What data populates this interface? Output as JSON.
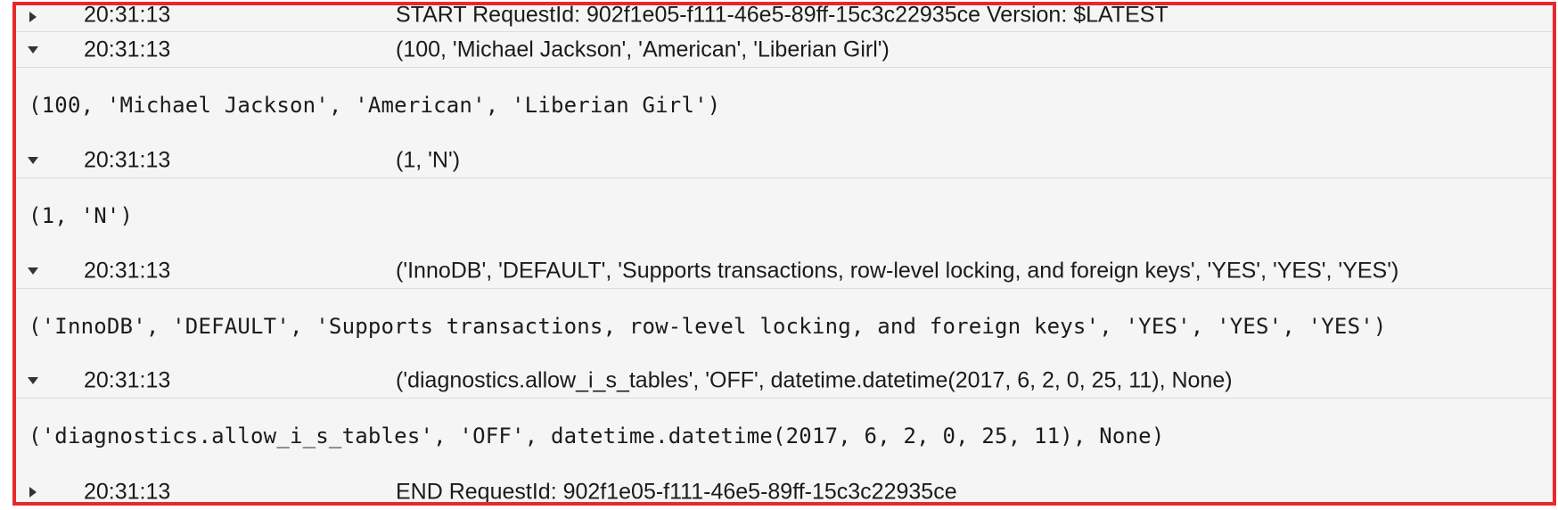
{
  "log": {
    "events": [
      {
        "time": "20:31:13",
        "message": "START RequestId: 902f1e05-f111-46e5-89ff-15c3c22935ce Version: $LATEST",
        "expanded": false
      },
      {
        "time": "20:31:13",
        "message": "(100, 'Michael Jackson', 'American', 'Liberian Girl')",
        "expanded": true,
        "detail": "(100, 'Michael Jackson', 'American', 'Liberian Girl')"
      },
      {
        "time": "20:31:13",
        "message": "(1, 'N')",
        "expanded": true,
        "detail": "(1, 'N')"
      },
      {
        "time": "20:31:13",
        "message": "('InnoDB', 'DEFAULT', 'Supports transactions, row-level locking, and foreign keys', 'YES', 'YES', 'YES')",
        "expanded": true,
        "detail": "('InnoDB', 'DEFAULT', 'Supports transactions, row-level locking, and foreign keys', 'YES', 'YES', 'YES')"
      },
      {
        "time": "20:31:13",
        "message": "('diagnostics.allow_i_s_tables', 'OFF', datetime.datetime(2017, 6, 2, 0, 25, 11), None)",
        "expanded": true,
        "detail": "('diagnostics.allow_i_s_tables', 'OFF', datetime.datetime(2017, 6, 2, 0, 25, 11), None)"
      },
      {
        "time": "20:31:13",
        "message": "END RequestId: 902f1e05-f111-46e5-89ff-15c3c22935ce",
        "expanded": false
      }
    ]
  },
  "colors": {
    "highlight_border": "#e8292b",
    "row_background": "#f5f5f5",
    "text": "#1b1b1b"
  },
  "icons": {
    "collapsed": "caret-right-icon",
    "expanded": "caret-down-icon"
  }
}
